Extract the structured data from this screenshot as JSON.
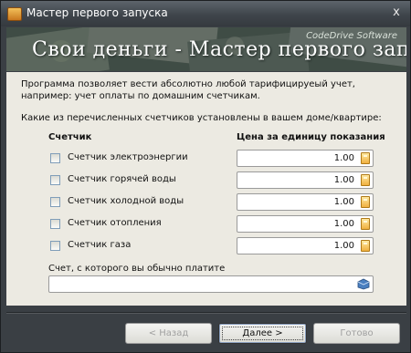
{
  "window": {
    "title": "Мастер первого запуска",
    "close_glyph": "x"
  },
  "banner": {
    "title": "Свои деньги - Мастер первого запуска",
    "brand": "CodeDrive Software"
  },
  "intro": {
    "line1": "Программа позволяет вести абсолютно любой тарифицируеый учет,",
    "line2": "например: учет оплаты по домашним счетчикам.",
    "question": "Какие из перечисленных счетчиков установлены в вашем доме/квартире:"
  },
  "table": {
    "col_meter": "Счетчик",
    "col_price": "Цена за единицу показания",
    "rows": [
      {
        "label": "Счетчик электроэнергии",
        "price": "1.00",
        "checked": false
      },
      {
        "label": "Счетчик горячей воды",
        "price": "1.00",
        "checked": false
      },
      {
        "label": "Счетчик холодной воды",
        "price": "1.00",
        "checked": false
      },
      {
        "label": "Счетчик отопления",
        "price": "1.00",
        "checked": false
      },
      {
        "label": "Счетчик газа",
        "price": "1.00",
        "checked": false
      }
    ]
  },
  "account": {
    "label": "Счет, с которого вы обычно платите",
    "value": ""
  },
  "buttons": {
    "back": "< Назад",
    "next": "Далее >",
    "finish": "Готово"
  },
  "icons": {
    "calc": "calculator-icon",
    "account": "wallet-icon"
  }
}
